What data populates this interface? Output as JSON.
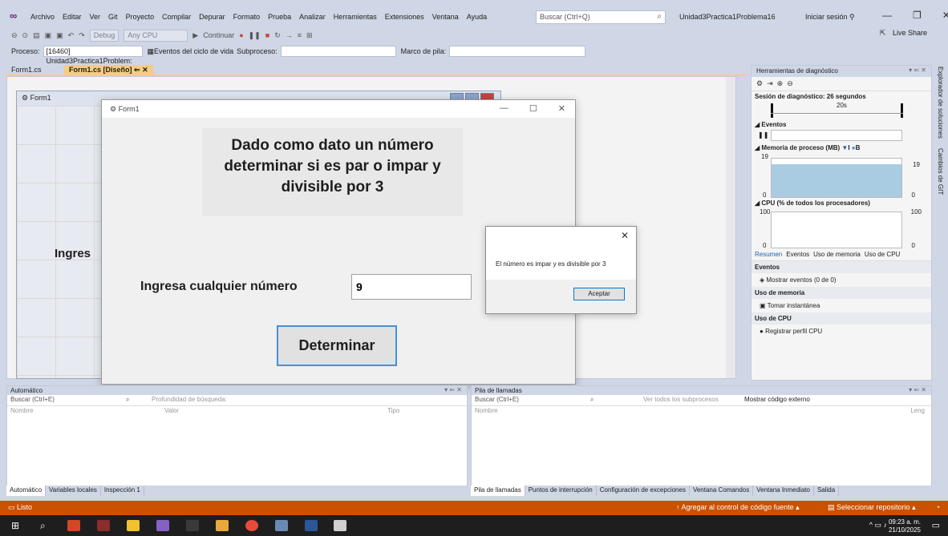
{
  "menu": {
    "items": [
      "Archivo",
      "Editar",
      "Ver",
      "Git",
      "Proyecto",
      "Compilar",
      "Depurar",
      "Formato",
      "Prueba",
      "Analizar",
      "Herramientas",
      "Extensiones",
      "Ventana",
      "Ayuda"
    ],
    "search_placeholder": "Buscar (Ctrl+Q)",
    "project_name": "Unidad3Practica1Problema16",
    "signin": "Iniciar sesión"
  },
  "toolbar": {
    "config": "Debug",
    "platform": "Any CPU",
    "continue": "Continuar",
    "liveshare": "Live Share"
  },
  "procbar": {
    "proceso_label": "Proceso:",
    "proceso_value": "[16460] Unidad3Practica1Problem:",
    "eventos": "Eventos del ciclo de vida",
    "subproceso": "Subproceso:",
    "marco": "Marco de pila:"
  },
  "tabs": [
    "Form1.cs",
    "Form1.cs [Diseño]"
  ],
  "designer": {
    "ghost_title": "Form1",
    "ghost_label": "Ingres"
  },
  "form": {
    "title": "Form1",
    "heading": "Dado como dato un número determinar si es par o impar y divisible por 3",
    "prompt": "Ingresa cualquier número",
    "input_value": "9",
    "button": "Determinar"
  },
  "msgbox": {
    "text": "El número es impar y es divisible por 3",
    "ok": "Aceptar"
  },
  "diagnostics": {
    "title": "Herramientas de diagnóstico",
    "session": "Sesión de diagnóstico: 26 segundos",
    "time_tick": "20s",
    "eventos": "Eventos",
    "memoria": "Memoria de proceso (MB)",
    "legend_i": "I",
    "legend_b": "B",
    "mem_max": "19",
    "mem_min": "0",
    "cpu": "CPU (% de todos los procesadores)",
    "cpu_max": "100",
    "cpu_min": "0",
    "subtabs": [
      "Resumen",
      "Eventos",
      "Uso de memoria",
      "Uso de CPU"
    ],
    "sec_eventos": "Eventos",
    "mostrar_eventos": "Mostrar eventos (0 de 0)",
    "sec_memoria": "Uso de memoria",
    "tomar": "Tomar instantánea",
    "sec_cpu": "Uso de CPU",
    "registrar": "Registrar perfil CPU"
  },
  "sidebar": {
    "explorer": "Explorador de soluciones",
    "git": "Cambios de GIT"
  },
  "auto_panel": {
    "title": "Automático",
    "search": "Buscar (Ctrl+E)",
    "depth": "Profundidad de búsqueda:",
    "col_nombre": "Nombre",
    "col_valor": "Valor",
    "col_tipo": "Tipo",
    "tabs": [
      "Automático",
      "Variables locales",
      "Inspección 1"
    ]
  },
  "call_panel": {
    "title": "Pila de llamadas",
    "search": "Buscar (Ctrl+E)",
    "ver_todos": "Ver todos los subprocesos",
    "mostrar_codigo": "Mostrar código externo",
    "col_nombre": "Nombre",
    "col_leng": "Leng",
    "tabs": [
      "Pila de llamadas",
      "Puntos de interrupción",
      "Configuración de excepciones",
      "Ventana Comandos",
      "Ventana Inmediato",
      "Salida"
    ]
  },
  "status": {
    "left": "Listo",
    "add_source": "Agregar al control de código fuente",
    "repo": "Seleccionar repositorio"
  },
  "taskbar": {
    "time": "09:23 a. m.",
    "date": "21/10/2025"
  },
  "colors": {
    "accent_tab": "#f5cc84",
    "status_bar": "#ca5100",
    "chrome": "#cfd6e5",
    "button_focus": "#4a8fd0"
  }
}
